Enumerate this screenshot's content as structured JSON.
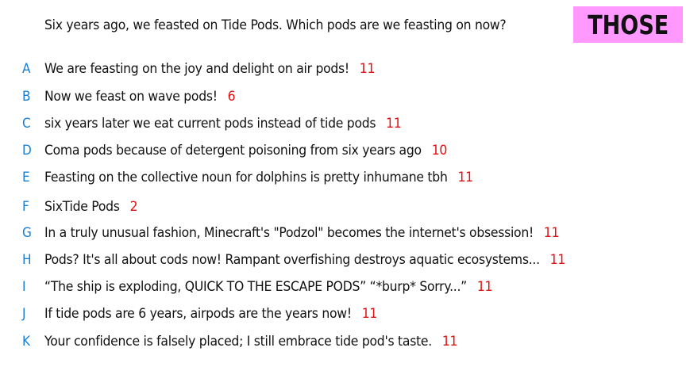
{
  "prompt": "Six years ago, we feasted on Tide Pods. Which pods are we feasting on now?",
  "badge": "THOSE",
  "colors": {
    "letter": "#1b7fd6",
    "count": "#dd1111",
    "badge_bg": "#ff99ff"
  },
  "options": [
    {
      "letter": "A",
      "text": "We are feasting on the joy and delight on air pods!",
      "count": "11"
    },
    {
      "letter": "B",
      "text": "Now we feast on wave pods!",
      "count": "6"
    },
    {
      "letter": "C",
      "text": "six years later we eat current pods instead of tide pods",
      "count": "11"
    },
    {
      "letter": "D",
      "text": "Coma pods because of detergent poisoning from six years ago",
      "count": "10"
    },
    {
      "letter": "E",
      "text": "Feasting on the collective noun for dolphins is pretty inhumane tbh",
      "count": "11"
    },
    {
      "letter": "F",
      "text": "SixTide Pods",
      "count": "2"
    },
    {
      "letter": "G",
      "text": "In a truly unusual fashion, Minecraft's \"Podzol\" becomes the internet's obsession!",
      "count": "11"
    },
    {
      "letter": "H",
      "text": "Pods? It's all about cods now! Rampant overfishing destroys aquatic ecosystems...",
      "count": "11"
    },
    {
      "letter": "I",
      "text": "“The ship is exploding, QUICK TO THE ESCAPE PODS” “*burp* Sorry...”",
      "count": "11"
    },
    {
      "letter": "J",
      "text": "If tide pods are 6 years, airpods are the years now!",
      "count": "11"
    },
    {
      "letter": "K",
      "text": "Your confidence is falsely placed; I still embrace tide pod's taste.",
      "count": "11"
    }
  ]
}
